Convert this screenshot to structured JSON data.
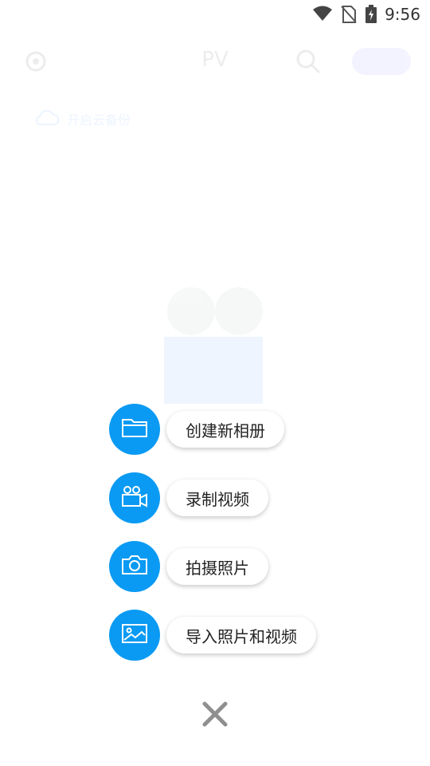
{
  "status_bar": {
    "time": "9:56"
  },
  "background": {
    "title": "PV",
    "backup_hint": "开启云备份"
  },
  "menu": {
    "items": [
      {
        "label": "创建新相册",
        "icon": "folder-icon"
      },
      {
        "label": "录制视频",
        "icon": "video-camera-icon"
      },
      {
        "label": "拍摄照片",
        "icon": "camera-icon"
      },
      {
        "label": "导入照片和视频",
        "icon": "image-import-icon"
      }
    ]
  },
  "colors": {
    "accent": "#0a9af3",
    "close": "#8f8f8f"
  }
}
